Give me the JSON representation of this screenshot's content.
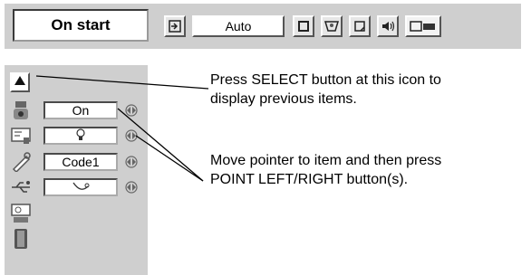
{
  "menu": {
    "title": "On start",
    "auto_label": "Auto",
    "icons": [
      "input-icon",
      "square-icon",
      "image-icon",
      "screen-icon",
      "sound-icon",
      "setting-icon"
    ]
  },
  "items": [
    {
      "icon": "up-arrow-icon"
    },
    {
      "icon": "fan-icon",
      "value": "On"
    },
    {
      "icon": "lamp-icon",
      "value": "bulb-symbol"
    },
    {
      "icon": "key-icon",
      "value": "Code1"
    },
    {
      "icon": "usb-icon",
      "value": "pointer-symbol"
    },
    {
      "icon": "lamp-counter-icon"
    },
    {
      "icon": "filter-icon"
    }
  ],
  "callouts": {
    "top_line1": "Press SELECT button at this icon to",
    "top_line2": "display previous items.",
    "bottom_line1": "Move pointer to item and then press",
    "bottom_line2": "POINT LEFT/RIGHT button(s)."
  }
}
